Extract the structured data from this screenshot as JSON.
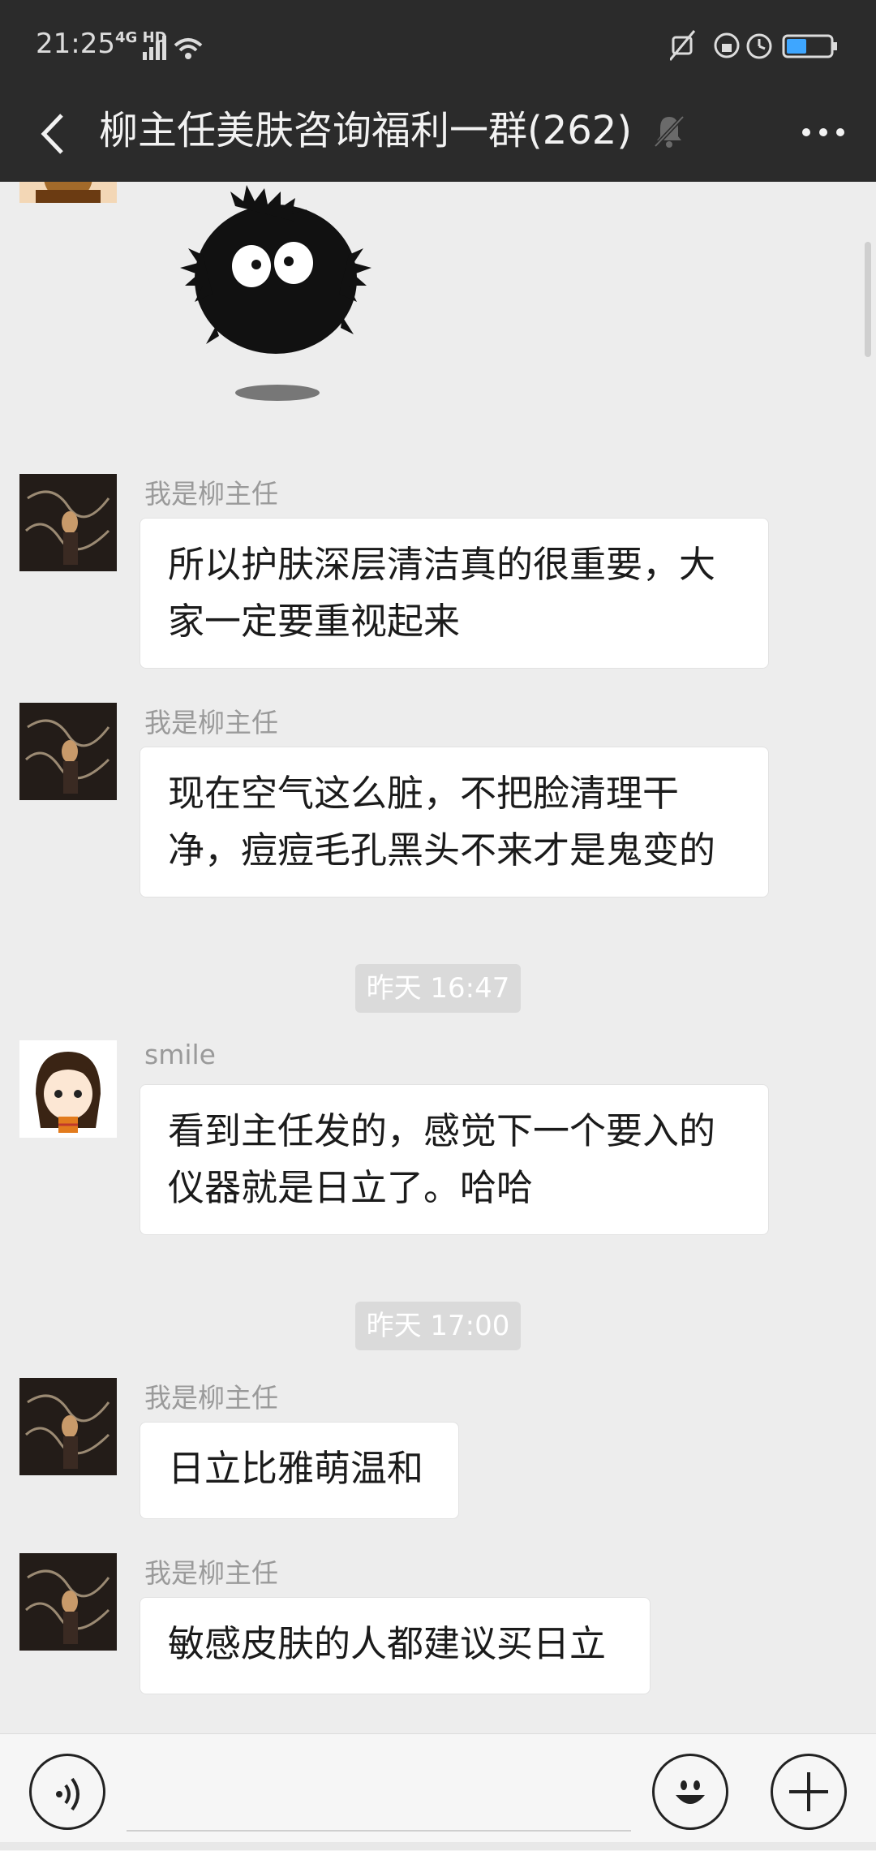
{
  "status": {
    "time": "21:25",
    "network": "4G HD"
  },
  "header": {
    "title": "柳主任美肤咨询福利一群(262)"
  },
  "messages": [
    {
      "sender": "我是柳主任",
      "text": "所以护肤深层清洁真的很重要，大家一定要重视起来"
    },
    {
      "sender": "我是柳主任",
      "text": "现在空气这么脏，不把脸清理干净，痘痘毛孔黑头不来才是鬼变的"
    },
    {
      "timestamp": "昨天 16:47"
    },
    {
      "sender": "smile",
      "text": "看到主任发的，感觉下一个要入的仪器就是日立了。哈哈"
    },
    {
      "timestamp": "昨天 17:00"
    },
    {
      "sender": "我是柳主任",
      "text": "日立比雅萌温和"
    },
    {
      "sender": "我是柳主任",
      "text": "敏感皮肤的人都建议买日立"
    }
  ],
  "icons": {
    "back": "chevron-left-icon",
    "mute": "bell-off-icon",
    "more": "more-horizontal-icon",
    "voice": "voice-icon",
    "emoji": "smile-icon",
    "plus": "plus-icon"
  },
  "colors": {
    "header_bg": "#2b2b2b",
    "chat_bg": "#ededed",
    "bubble_bg": "#ffffff",
    "timestamp_bg": "#dadada"
  }
}
